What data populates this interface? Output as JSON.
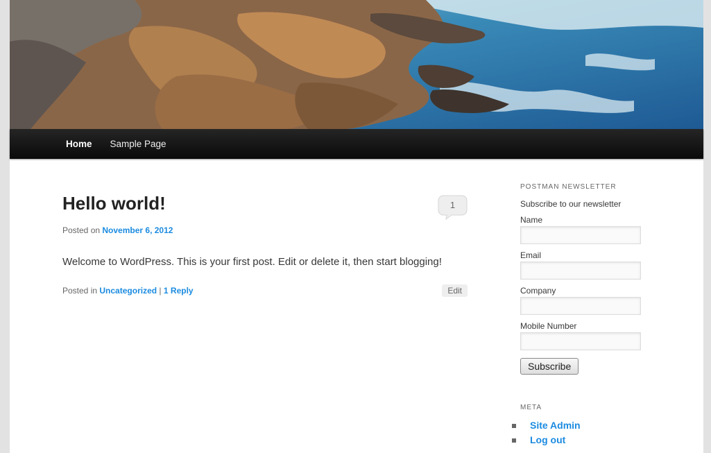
{
  "nav": {
    "items": [
      {
        "label": "Home"
      },
      {
        "label": "Sample Page"
      }
    ]
  },
  "post": {
    "title": "Hello world!",
    "comment_count": "1",
    "posted_on_label": "Posted on",
    "date": "November 6, 2012",
    "content": "Welcome to WordPress. This is your first post. Edit or delete it, then start blogging!",
    "posted_in_label": "Posted in",
    "category": "Uncategorized",
    "separator": "|",
    "reply_link": "1 Reply",
    "edit_label": "Edit"
  },
  "newsletter": {
    "title": "POSTMAN NEWSLETTER",
    "description": "Subscribe to our newsletter",
    "fields": [
      {
        "label": "Name",
        "value": ""
      },
      {
        "label": "Email",
        "value": ""
      },
      {
        "label": "Company",
        "value": ""
      },
      {
        "label": "Mobile Number",
        "value": ""
      }
    ],
    "button_label": "Subscribe"
  },
  "meta": {
    "title": "META",
    "links": [
      "Site Admin",
      "Log out"
    ]
  },
  "colors": {
    "link": "#1b8be0",
    "nav_bg": "#111111",
    "page_bg": "#e2e2e2"
  }
}
